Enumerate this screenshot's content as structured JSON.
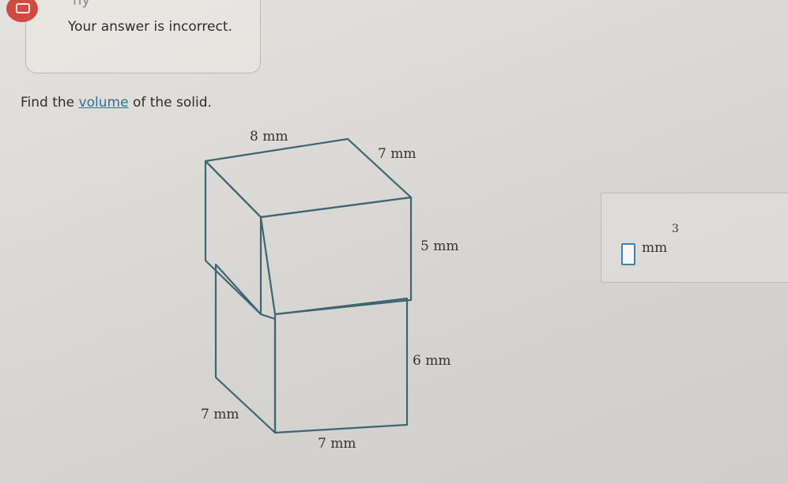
{
  "feedback": {
    "partial_top_text": "ny",
    "message": "Your answer is incorrect."
  },
  "question": {
    "prefix": "Find the",
    "link": "volume",
    "suffix": "of the solid."
  },
  "figure": {
    "top_width": "8 mm",
    "top_depth": "7 mm",
    "upper_height": "5 mm",
    "lower_height": "6 mm",
    "bottom_depth": "7 mm",
    "bottom_width": "7 mm"
  },
  "answer": {
    "value": "",
    "unit": "mm",
    "exponent": "3"
  },
  "colors": {
    "figure_stroke": "#3c6670",
    "link": "#2f6f9a",
    "input_border": "#3d7fb0",
    "alert_icon": "#d24a3f"
  }
}
